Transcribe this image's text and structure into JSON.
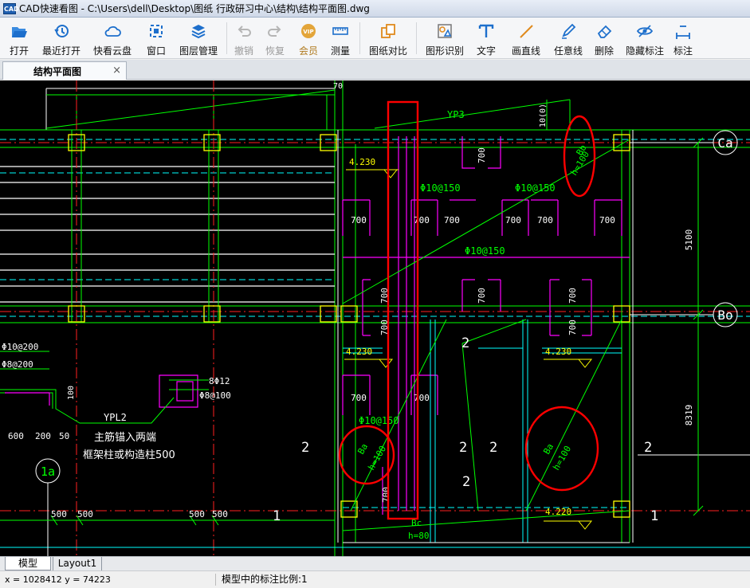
{
  "window": {
    "title": "CAD快速看图 - C:\\Users\\dell\\Desktop\\图纸 行政研习中心\\结构\\结构平面图.dwg",
    "icon_label": "CAD"
  },
  "toolbar": {
    "buttons": [
      {
        "label": "打开",
        "icon": "folder-open-icon"
      },
      {
        "label": "最近打开",
        "icon": "recent-clock-icon"
      },
      {
        "label": "快看云盘",
        "icon": "cloud-icon"
      },
      {
        "label": "窗口",
        "icon": "window-icon"
      },
      {
        "label": "图层管理",
        "icon": "layers-icon"
      },
      {
        "label": "撤销",
        "icon": "undo-icon"
      },
      {
        "label": "恢复",
        "icon": "redo-icon"
      },
      {
        "label": "会员",
        "icon": "vip-icon"
      },
      {
        "label": "测量",
        "icon": "ruler-icon"
      },
      {
        "label": "图纸对比",
        "icon": "compare-icon"
      },
      {
        "label": "图形识别",
        "icon": "shape-recognition-icon"
      },
      {
        "label": "文字",
        "icon": "text-t-icon"
      },
      {
        "label": "画直线",
        "icon": "line-icon"
      },
      {
        "label": "任意线",
        "icon": "pen-icon"
      },
      {
        "label": "删除",
        "icon": "eraser-icon"
      },
      {
        "label": "隐藏标注",
        "icon": "eye-icon"
      },
      {
        "label": "标注",
        "icon": "annotate-icon"
      }
    ]
  },
  "tabs": {
    "document": "结构平面图",
    "close": "×"
  },
  "drawing": {
    "dims": {
      "d700": "700",
      "d100": "100",
      "d500": "500",
      "d600": "600",
      "d200": "200",
      "d50": "50",
      "d70": "70",
      "d5100": "5100",
      "d8319": "8319",
      "d1000": "10(0)"
    },
    "labels": {
      "yp3": "YP3",
      "yp12": "YPL2",
      "rebar150a": "Φ10@150",
      "rebar150b": "Φ10@150",
      "rebar150c": "Φ10@150",
      "rebar150d": "Φ10@150",
      "rebar200a": "Φ10@200",
      "rebar200b": "Φ8@200",
      "bar8": "8Φ12",
      "stirrup": "Φ8@100",
      "elev1": "4.230",
      "elev2": "4.230",
      "elev3": "4.230",
      "elev4": "4.220",
      "note1": "主筋锚入两端",
      "note2": "框架柱或构造柱500",
      "axis_ca": "Ca",
      "axis_bo": "Bo",
      "axis_1a": "1a",
      "slab_bb": "Bb",
      "slab_h100": "h=100",
      "slab_ba": "Ba",
      "slab_bc": "Bc",
      "slab_h80": "h=80",
      "num2": "2",
      "num1": "1"
    }
  },
  "layout_tabs": {
    "model": "模型",
    "layout1": "Layout1"
  },
  "status": {
    "coords": "x = 1028412  y = 74223",
    "scale": "模型中的标注比例:1"
  },
  "colors": {
    "canvas_bg": "#000000",
    "cad_green": "#00ff00",
    "cad_white": "#ffffff",
    "cad_yellow": "#ffff00",
    "cad_magenta": "#ff00ff",
    "cad_cyan": "#00ffff",
    "cad_red": "#ff2020",
    "highlight_red": "#ff0000"
  }
}
